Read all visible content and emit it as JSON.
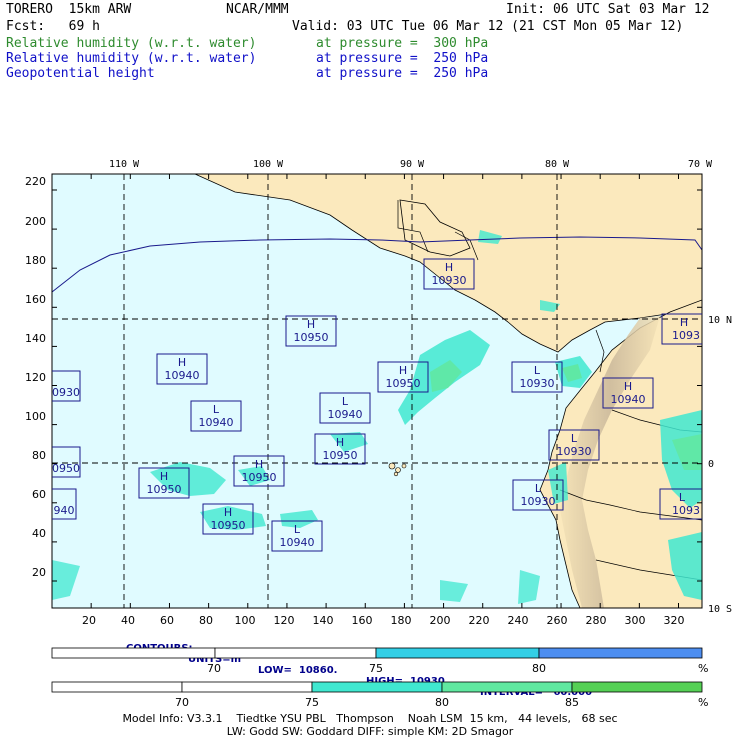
{
  "header": {
    "model": "TORERO  15km ARW",
    "center": "NCAR/MMM",
    "init": "Init: 06 UTC Sat 03 Mar 12",
    "fcst": "Fcst:   69 h",
    "valid": "Valid: 03 UTC Tue 06 Mar 12 (21 CST Mon 05 Mar 12)",
    "fields": [
      {
        "name": "Relative humidity (w.r.t. water)",
        "level": "at pressure =  300 hPa",
        "color": "#2e8b2e"
      },
      {
        "name": "Relative humidity (w.r.t. water)",
        "level": "at pressure =  250 hPa",
        "color": "#1010c8"
      },
      {
        "name": "Geopotential height",
        "level": "at pressure =  250 hPa",
        "color": "#1010c8"
      }
    ]
  },
  "map": {
    "lon_labels": [
      "110 W",
      "100 W",
      "90 W",
      "80 W",
      "70 W"
    ],
    "lat_labels": [
      "10 N",
      "0",
      "10 S"
    ],
    "y_ticks": [
      "220",
      "200",
      "180",
      "160",
      "140",
      "120",
      "100",
      "80",
      "60",
      "40",
      "20"
    ],
    "x_ticks": [
      "20",
      "40",
      "60",
      "80",
      "100",
      "120",
      "140",
      "160",
      "180",
      "200",
      "220",
      "240",
      "260",
      "280",
      "300",
      "320"
    ],
    "ocean_color": "#e0fbff",
    "land_color": "#fbe9bd",
    "systems": [
      {
        "type": "H",
        "value": "10930"
      },
      {
        "type": "H",
        "value": "10950"
      },
      {
        "type": "H",
        "value": "10940"
      },
      {
        "type": "L",
        "value": "10940"
      },
      {
        "type": "H",
        "value": "10950"
      },
      {
        "type": "L",
        "value": "10940"
      },
      {
        "type": "H",
        "value": "10950"
      },
      {
        "type": "L",
        "value": "10930"
      },
      {
        "type": "H",
        "value": "10940"
      },
      {
        "type": "L",
        "value": "10930"
      },
      {
        "type": "L",
        "value": "10930"
      },
      {
        "type": "H",
        "value": "10950"
      },
      {
        "type": "H",
        "value": "10950"
      },
      {
        "type": "H",
        "value": "10950"
      },
      {
        "type": "L",
        "value": "10940"
      },
      {
        "type": "H",
        "value": "1093"
      },
      {
        "type": "L",
        "value": "1093"
      },
      {
        "type": "",
        "value": "0930"
      },
      {
        "type": "",
        "value": "0950"
      },
      {
        "type": "",
        "value": "940"
      }
    ]
  },
  "contours": {
    "label": "CONTOURS:",
    "units": "UNITS=m",
    "low": "LOW=  10860.",
    "high": "HIGH=  10930.",
    "interval": "INTERVAL=   60.000"
  },
  "colorbar_250": {
    "ticks": [
      "70",
      "75",
      "80"
    ],
    "unit": "%",
    "colors": [
      "#ffffff",
      "#33cfe6",
      "#4d8ef0"
    ]
  },
  "colorbar_300": {
    "ticks": [
      "70",
      "75",
      "80",
      "85"
    ],
    "unit": "%",
    "colors": [
      "#ffffff",
      "#40e8d0",
      "#60e8a0",
      "#55d055"
    ]
  },
  "model_info": {
    "line1": "Model Info: V3.3.1    Tiedtke YSU PBL   Thompson    Noah LSM  15 km,   44 levels,   68 sec",
    "line2": "LW: Godd SW: Goddard DIFF: simple KM: 2D Smagor"
  }
}
